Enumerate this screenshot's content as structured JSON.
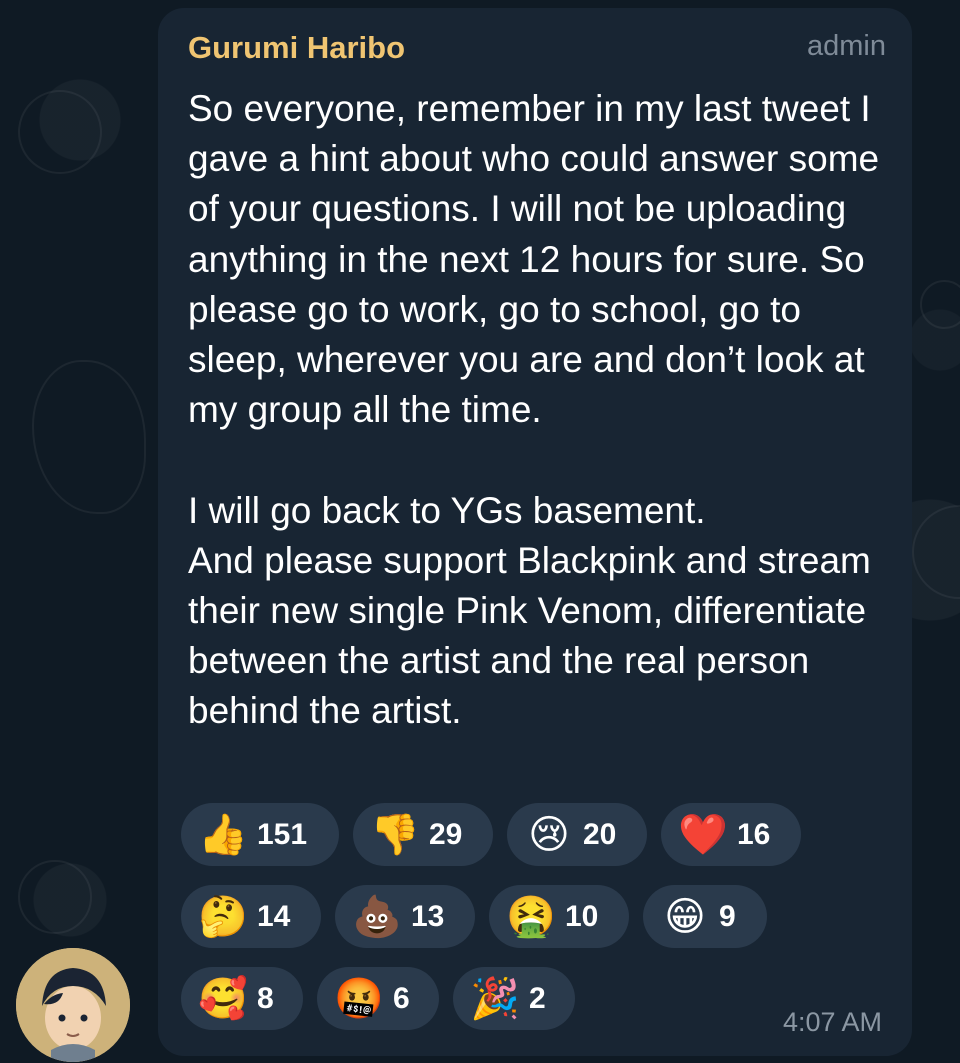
{
  "message": {
    "sender": "Gurumi Haribo",
    "role": "admin",
    "text": "So everyone, remember in my last tweet I gave a hint about who could answer some of your questions. I will not be uploading anything in the next 12 hours for sure. So please go to work, go to school, go to sleep, wherever you are and don’t look at my group all the time.\n\nI will go back to YGs basement.\nAnd please support Blackpink and stream their new single Pink Venom, differentiate between the artist and the real person behind the artist.",
    "time": "4:07 AM"
  },
  "reactions": [
    {
      "emoji": "thumbs-up",
      "glyph": "👍",
      "count": "151"
    },
    {
      "emoji": "thumbs-down",
      "glyph": "👎",
      "count": "29"
    },
    {
      "emoji": "crying-face",
      "glyph": "😢",
      "count": "20"
    },
    {
      "emoji": "red-heart",
      "glyph": "❤️",
      "count": "16"
    },
    {
      "emoji": "thinking-face",
      "glyph": "🤔",
      "count": "14"
    },
    {
      "emoji": "pile-of-poo",
      "glyph": "💩",
      "count": "13"
    },
    {
      "emoji": "vomiting-face",
      "glyph": "🤮",
      "count": "10"
    },
    {
      "emoji": "grinning-face",
      "glyph": "😁",
      "count": "9"
    },
    {
      "emoji": "smiling-face-with-hearts",
      "glyph": "🥰",
      "count": "8"
    },
    {
      "emoji": "face-with-symbols-on-mouth",
      "glyph": "🤬",
      "count": "6"
    },
    {
      "emoji": "party-popper",
      "glyph": "🎉",
      "count": "2"
    }
  ],
  "colors": {
    "background": "#0f1a24",
    "bubble": "#182533",
    "sender": "#f0c572",
    "meta": "#7f8b98",
    "reaction_pill": "#2a3a4c"
  }
}
